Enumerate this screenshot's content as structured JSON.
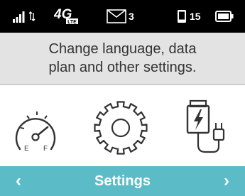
{
  "status_bar": {
    "signal_icon": "signal-bars-icon",
    "data_activity_icon": "up-down-arrows-icon",
    "network_label": "4G",
    "network_sublabel": "LTE",
    "messages_icon": "envelope-icon",
    "messages_count": "3",
    "devices_icon": "connected-device-icon",
    "devices_count": "15",
    "battery_icon": "battery-icon"
  },
  "banner": {
    "line1": "Change language, data",
    "line2": "plan and other settings."
  },
  "carousel": {
    "items": [
      {
        "icon": "gauge-icon",
        "selected": false
      },
      {
        "icon": "gear-icon",
        "selected": true
      },
      {
        "icon": "battery-charger-icon",
        "selected": false
      }
    ],
    "gauge_labels": {
      "empty": "E",
      "full": "F"
    }
  },
  "nav": {
    "title": "Settings",
    "prev_label": "‹",
    "next_label": "›"
  },
  "colors": {
    "status_bg": "#000000",
    "banner_bg": "#e3e3e3",
    "nav_bg": "#5bbcc7",
    "icon_stroke": "#333333"
  }
}
